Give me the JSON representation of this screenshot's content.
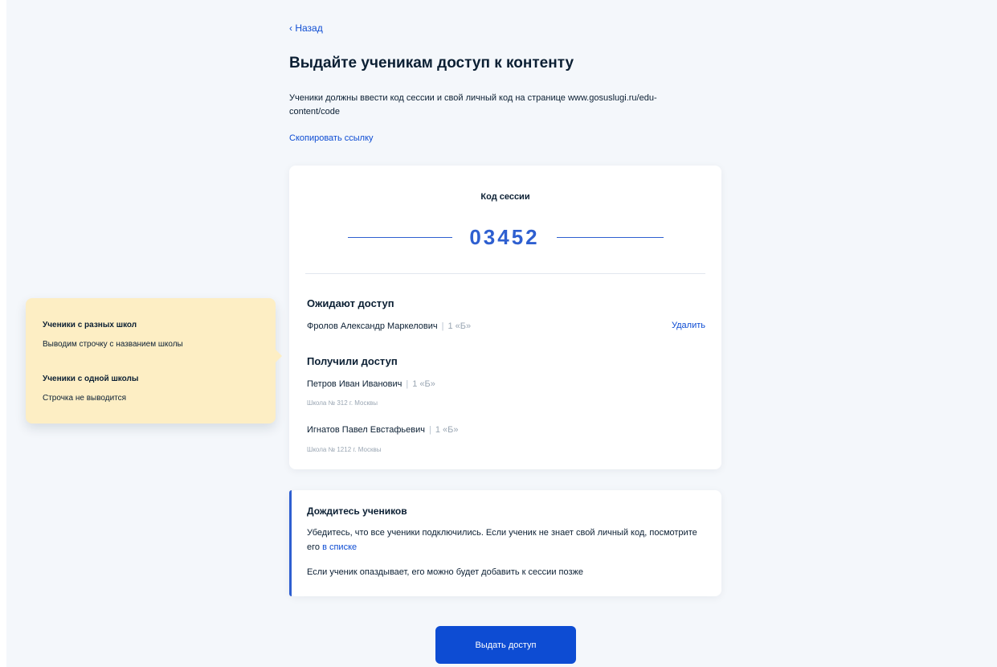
{
  "navigation": {
    "back_label": "‹ Назад"
  },
  "header": {
    "title": "Выдайте ученикам доступ к контенту",
    "description": "Ученики должны ввести код сессии и свой личный код на странице www.gosuslugi.ru/edu-content/code",
    "copy_link_label": "Скопировать ссылку"
  },
  "session": {
    "label": "Код сессии",
    "code": "03452"
  },
  "waiting": {
    "title": "Ожидают доступ",
    "students": [
      {
        "name": "Фролов Александр Маркелович",
        "separator": "|",
        "class": "1 «Б»",
        "delete_label": "Удалить"
      }
    ]
  },
  "granted": {
    "title": "Получили доступ",
    "students": [
      {
        "name": "Петров Иван Иванович",
        "separator": "|",
        "class": "1 «Б»",
        "school": "Школа № 312 г. Москвы"
      },
      {
        "name": "Игнатов Павел Евстафьевич",
        "separator": "|",
        "class": "1 «Б»",
        "school": "Школа № 1212 г. Москвы"
      }
    ]
  },
  "info": {
    "title": "Дождитесь учеников",
    "text1": "Убедитесь, что все ученики подключились. Если ученик не знает свой личный код, посмотрите его ",
    "text1_link": "в списке",
    "text2": "Если ученик опаздывает, его можно будет добавить к сессии позже"
  },
  "actions": {
    "grant_access_label": "Выдать доступ"
  },
  "annotation": {
    "heading1": "Ученики с разных школ",
    "text1": "Выводим строчку с названием школы",
    "heading2": "Ученики с одной школы",
    "text2": "Строчка не выводится"
  },
  "colors": {
    "accent": "#0d4cd3",
    "code": "#2e5fd0",
    "background": "#f4f7fb",
    "note": "#fdeec4"
  }
}
